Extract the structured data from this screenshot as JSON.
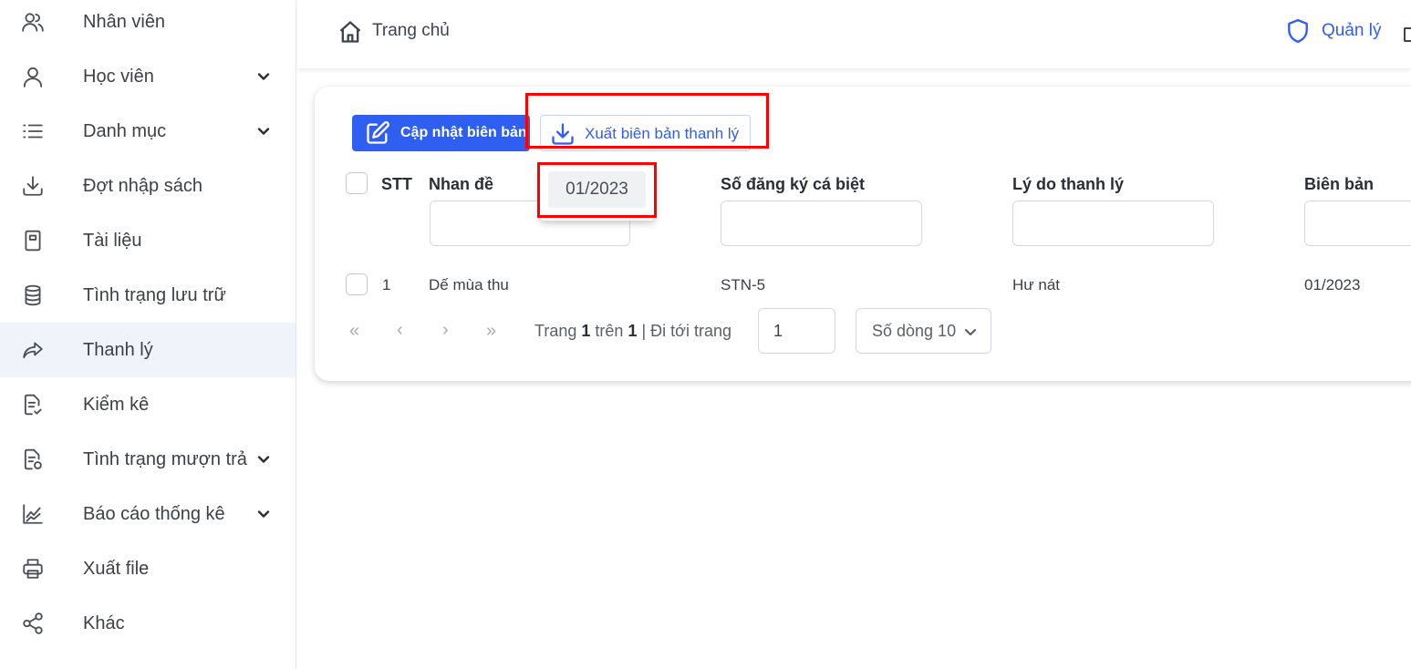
{
  "sidebar": {
    "items": [
      {
        "label": "Nhân viên",
        "icon": "users-icon",
        "has_chevron": false
      },
      {
        "label": "Học viên",
        "icon": "user-icon",
        "has_chevron": true
      },
      {
        "label": "Danh mục",
        "icon": "list-icon",
        "has_chevron": true
      },
      {
        "label": "Đợt nhập sách",
        "icon": "download-icon",
        "has_chevron": false
      },
      {
        "label": "Tài liệu",
        "icon": "document-icon",
        "has_chevron": false
      },
      {
        "label": "Tình trạng lưu trữ",
        "icon": "database-icon",
        "has_chevron": false
      },
      {
        "label": "Thanh lý",
        "icon": "share-arrow-icon",
        "has_chevron": false,
        "active": true
      },
      {
        "label": "Kiểm kê",
        "icon": "checklist-icon",
        "has_chevron": false
      },
      {
        "label": "Tình trạng mượn trả",
        "icon": "file-refresh-icon",
        "has_chevron": true
      },
      {
        "label": "Báo cáo thống kê",
        "icon": "chart-line-icon",
        "has_chevron": true
      },
      {
        "label": "Xuất file",
        "icon": "printer-icon",
        "has_chevron": false
      },
      {
        "label": "Khác",
        "icon": "share-nodes-icon",
        "has_chevron": false
      }
    ]
  },
  "header": {
    "breadcrumb": "Trang chủ",
    "role_label": "Quản lý"
  },
  "toolbar": {
    "update_label": "Cập nhật biên bản",
    "export_label": "Xuất biên bản thanh lý"
  },
  "dropdown": {
    "option": "01/2023"
  },
  "table": {
    "headers": {
      "stt": "STT",
      "title": "Nhan đề",
      "reg_no": "Số đăng ký cá biệt",
      "reason": "Lý do thanh lý",
      "record": "Biên bản"
    },
    "rows": [
      {
        "stt": "1",
        "title": "Dế mùa thu",
        "reg_no": "STN-5",
        "reason": "Hư nát",
        "record": "01/2023"
      }
    ]
  },
  "pagination": {
    "page_word": "Trang",
    "current": "1",
    "of_word": "trên",
    "total": "1",
    "goto_label": "Đi tới trang",
    "goto_value": "1",
    "rows_label": "Số dòng 10"
  },
  "colors": {
    "accent": "#2f5ff0",
    "highlight": "#ff0000",
    "active_bg": "#f0f3fa"
  }
}
